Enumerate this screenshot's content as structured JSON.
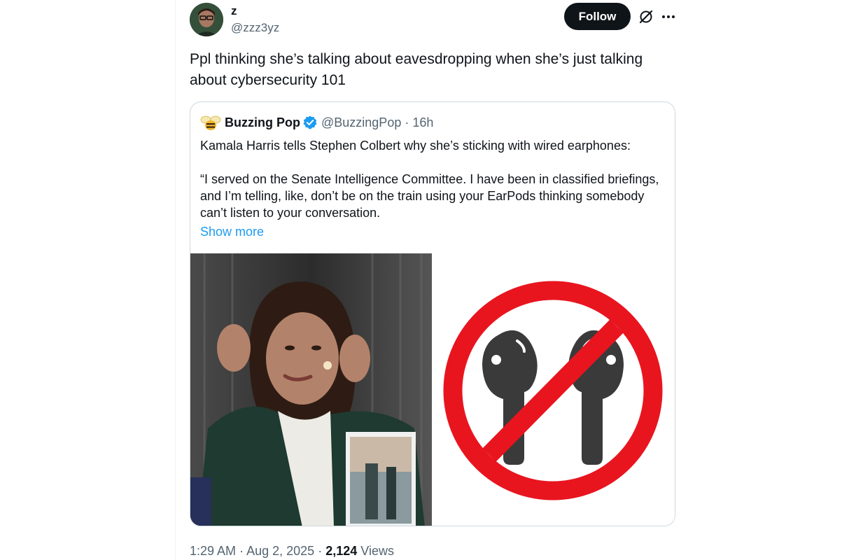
{
  "author": {
    "display_name": "z",
    "handle": "@zzz3yz",
    "avatar_icon": "user-avatar"
  },
  "actions": {
    "follow_label": "Follow",
    "grok_icon": "grok-icon",
    "more_icon": "more-icon"
  },
  "tweet": {
    "text": "Ppl thinking she’s talking about eavesdropping when she’s just talking about cybersecurity 101"
  },
  "quoted_tweet": {
    "display_name": "Buzzing Pop",
    "handle": "@BuzzingPop",
    "separator": "·",
    "time": "16h",
    "text_line1": "Kamala Harris tells Stephen Colbert why she’s sticking with wired earphones:",
    "text_quote": "“I served on the Senate Intelligence Committee. I have been in classified briefings, and I’m telling, like, don’t be on the train using your EarPods thinking somebody can’t listen to your conversation.",
    "show_more": "Show more",
    "avatar_icon": "bee-icon",
    "verified_icon": "verified-badge-icon",
    "verified_color": "#1d9bf0"
  },
  "media": {
    "left_image": "interview-photo",
    "right_image": "no-earbuds-icon",
    "prohibit_color": "#e8151f",
    "earbud_color": "#3a3a3a"
  },
  "footer": {
    "time": "1:29 AM",
    "separator1": "·",
    "date": "Aug 2, 2025",
    "separator2": "·",
    "views_count": "2,124",
    "views_label": "Views"
  }
}
